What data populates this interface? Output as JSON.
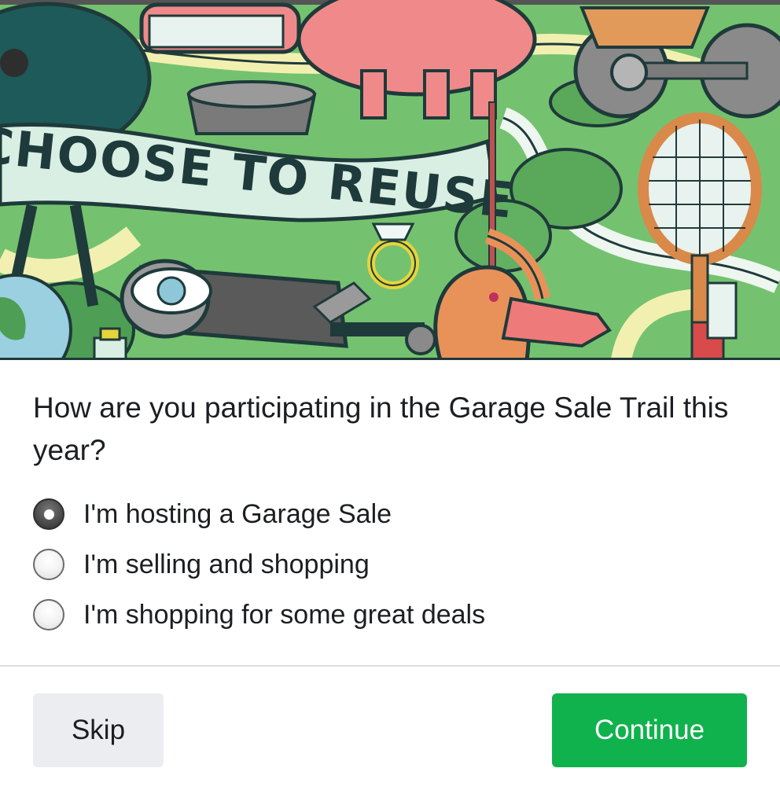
{
  "hero": {
    "banner_text": "CHOOSE TO REUSE",
    "image": "garage-sale-illustration"
  },
  "question": "How are you participating in the Garage Sale Trail this year?",
  "options": [
    {
      "label": "I'm hosting a Garage Sale",
      "selected": true
    },
    {
      "label": "I'm selling and shopping",
      "selected": false
    },
    {
      "label": "I'm shopping for some great deals",
      "selected": false
    }
  ],
  "buttons": {
    "skip_label": "Skip",
    "continue_label": "Continue"
  },
  "colors": {
    "continue_bg": "#0fb24c",
    "skip_bg": "#ebedf0",
    "text": "#1c1e21"
  }
}
